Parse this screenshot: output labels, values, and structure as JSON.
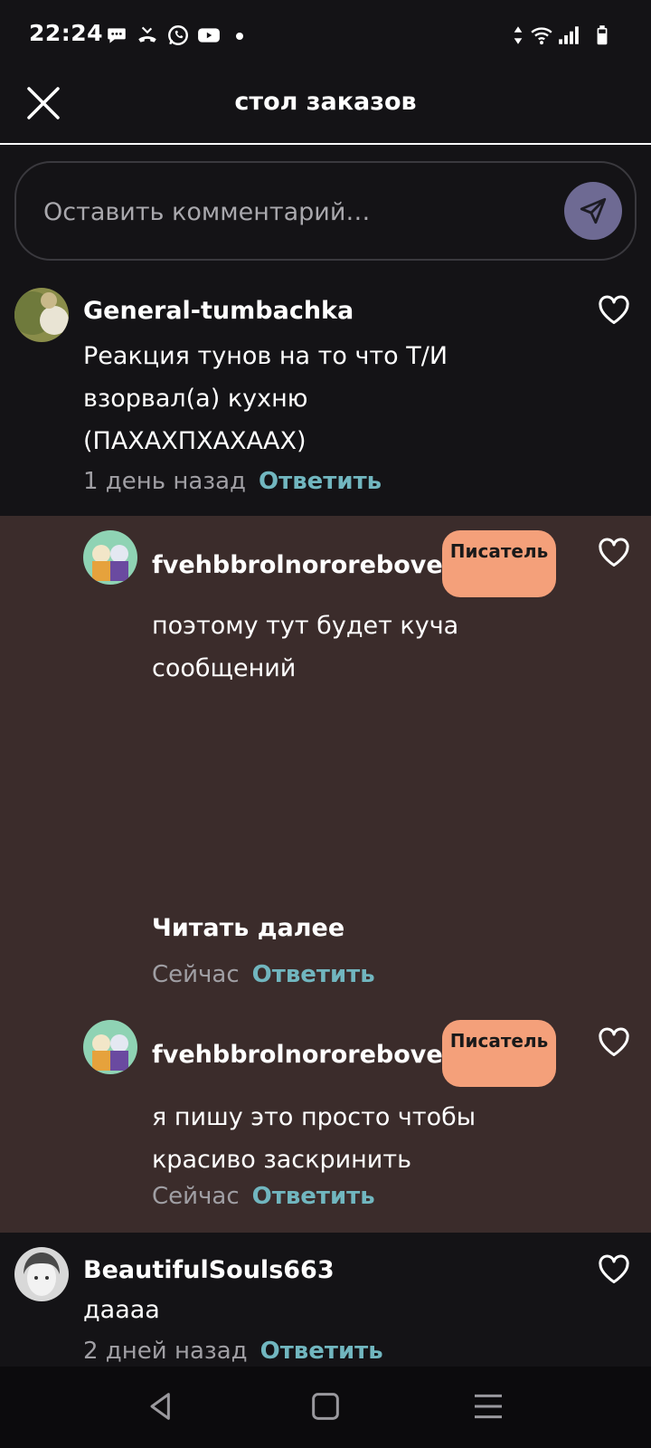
{
  "status_bar": {
    "time": "22:24",
    "left_icons": [
      "chat-bubble-icon",
      "missed-call-icon",
      "whatsapp-icon",
      "youtube-icon",
      "notification-dot-icon"
    ],
    "right_icons": [
      "data-arrows-icon",
      "wifi-icon",
      "signal-icon",
      "battery-icon"
    ]
  },
  "header": {
    "title": "стол заказов",
    "close_icon": "close-icon"
  },
  "composer": {
    "placeholder": "Оставить комментарий…",
    "send_icon": "send-icon"
  },
  "comments": [
    {
      "username": "General-tumbachka",
      "text": "Реакция тунов на то что Т/И взорвал(а) кухню (ПАХАХПХАХААХ)",
      "time": "1 день назад",
      "reply_label": "Ответить"
    },
    {
      "username": "fvehbbrolnororebove",
      "badge": "Писатель",
      "text": "поэтому тут будет куча сообщений",
      "read_more": "Читать далее",
      "time": "Сейчас",
      "reply_label": "Ответить"
    },
    {
      "username": "fvehbbrolnororebove",
      "badge": "Писатель",
      "text": "я пишу это просто чтобы красиво заскринить",
      "time": "Сейчас",
      "reply_label": "Ответить"
    },
    {
      "username": "BeautifulSouls663",
      "text": "даааа",
      "time": "2 дней назад",
      "reply_label": "Ответить"
    }
  ],
  "nav_bar": {
    "buttons": [
      "back-icon",
      "home-icon",
      "recents-icon"
    ]
  },
  "colors": {
    "background": "#141316",
    "reply_background": "#3b2c2b",
    "accent_link": "#71b6bf",
    "badge": "#f4a07a",
    "send_button": "#6e6a93"
  }
}
